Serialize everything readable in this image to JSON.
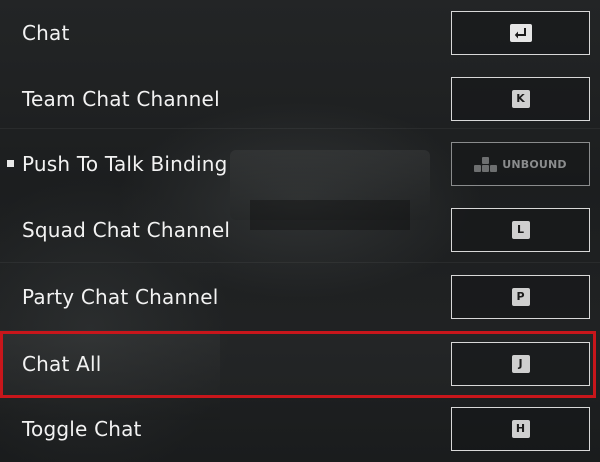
{
  "keybindings": [
    {
      "label": "Chat",
      "key": "↵",
      "key_kind": "enter-icon",
      "bound": true,
      "selected": false,
      "hovered": false
    },
    {
      "label": "Team Chat Channel",
      "key": "K",
      "key_kind": "letter",
      "bound": true,
      "selected": false,
      "hovered": false
    },
    {
      "label": "Push To Talk Binding",
      "key": "UNBOUND",
      "key_kind": "unbound",
      "bound": false,
      "selected": false,
      "hovered": true
    },
    {
      "label": "Squad Chat Channel",
      "key": "L",
      "key_kind": "letter",
      "bound": true,
      "selected": false,
      "hovered": false
    },
    {
      "label": "Party Chat Channel",
      "key": "P",
      "key_kind": "letter",
      "bound": true,
      "selected": false,
      "hovered": false
    },
    {
      "label": "Chat All",
      "key": "J",
      "key_kind": "letter",
      "bound": true,
      "selected": true,
      "hovered": false
    },
    {
      "label": "Toggle Chat",
      "key": "H",
      "key_kind": "letter",
      "bound": true,
      "selected": false,
      "hovered": false
    }
  ],
  "colors": {
    "text": "#f2f2f2",
    "selection_border": "#c8161b",
    "key_border": "#d8d8d8",
    "key_cap": "#cfcfcf",
    "unbound_text": "#8a8c8d"
  },
  "icons": {
    "enter_key": "enter-key-icon",
    "unbound": "keyboard-keys-icon"
  }
}
